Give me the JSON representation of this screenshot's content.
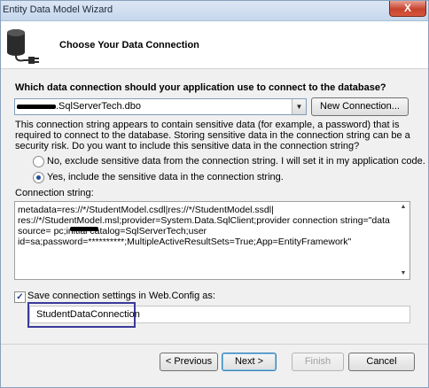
{
  "window": {
    "title": "Entity Data Model Wizard",
    "close_label": "X"
  },
  "header": {
    "title": "Choose Your Data Connection",
    "icon": "database-plug-icon"
  },
  "connection": {
    "question": "Which data connection should your application use to connect to the database?",
    "selected": ".SqlServerTech.dbo",
    "new_connection_label": "New Connection..."
  },
  "sensitive": {
    "description": "This connection string appears to contain sensitive data (for example, a password) that is required to connect to the database. Storing sensitive data in the connection string can be a security risk. Do you want to include this sensitive data in the connection string?",
    "option_no": "No, exclude sensitive data from the connection string. I will set it in my application code.",
    "option_yes": "Yes, include the sensitive data in the connection string.",
    "selected_option": "yes"
  },
  "connection_string": {
    "label": "Connection string:",
    "line1": "metadata=res://*/StudentModel.csdl|res://*/StudentModel.ssdl|",
    "line2": "res://*/StudentModel.msl;provider=System.Data.SqlClient;provider connection string=\"data",
    "line3": "source=         pc;initial catalog=SqlServerTech;user",
    "line4": "id=sa;password=**********;MultipleActiveResultSets=True;App=EntityFramework\""
  },
  "save_settings": {
    "checked": true,
    "label": "Save connection settings in Web.Config as:",
    "name": "StudentDataConnection"
  },
  "buttons": {
    "previous": "< Previous",
    "next": "Next >",
    "finish": "Finish",
    "cancel": "Cancel"
  }
}
